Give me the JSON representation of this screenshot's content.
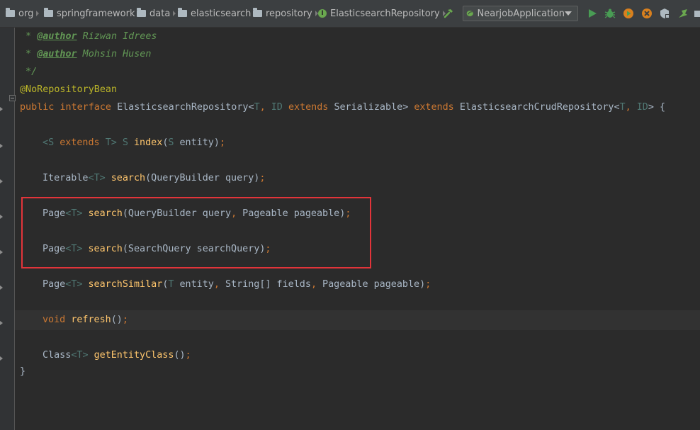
{
  "breadcrumbs": [
    "org",
    "springframework",
    "data",
    "elasticsearch",
    "repository",
    "ElasticsearchRepository"
  ],
  "interface_icon_letter": "I",
  "run_configuration": "NearjobApplication",
  "toolbar_icons": [
    "hammer-icon",
    "run-icon",
    "debug-icon",
    "coverage-icon",
    "profile-icon",
    "stop-icon",
    "jrebel-icon"
  ],
  "colors": {
    "background": "#2b2b2b",
    "keyword": "#cc7832",
    "method": "#ffc66d",
    "comment": "#629755",
    "annotation": "#bbb529",
    "type_param": "#507874",
    "highlight_box": "#e2343a"
  },
  "code": {
    "l1": {
      "star": " * ",
      "tag": "@author",
      "rest": " Rizwan Idrees"
    },
    "l2": {
      "star": " * ",
      "tag": "@author",
      "rest": " Mohsin Husen"
    },
    "l3": " */",
    "l4": "@NoRepositoryBean",
    "l5": {
      "public": "public",
      "interface": "interface",
      "name": "ElasticsearchRepository",
      "lt": "<",
      "T": "T",
      "comma": ",",
      "ID": "ID",
      "extends1": "extends",
      "ser": "Serializable",
      "gt": ">",
      "extends2": "extends",
      "crud": "ElasticsearchCrudRepository",
      "lt2": "<",
      "T2": "T",
      "comma2": ",",
      "ID2": "ID",
      "gt2": ">",
      "brace": "{"
    },
    "l7": {
      "lt": "<",
      "S": "S",
      "extends": "extends",
      "T": "T",
      "gt": ">",
      "S2": "S",
      "fn": "index",
      "lp": "(",
      "S3": "S",
      "arg": "entity",
      "rp": ")",
      "semi": ";"
    },
    "l9": {
      "type": "Iterable",
      "lt": "<",
      "T": "T",
      "gt": ">",
      "fn": "search",
      "args": "(QueryBuilder query)",
      "semi": ";"
    },
    "l11": {
      "type": "Page",
      "lt": "<",
      "T": "T",
      "gt": ">",
      "fn": "search",
      "a1": "(QueryBuilder query",
      "comma": ",",
      "a2": " Pageable pageable)",
      "semi": ";"
    },
    "l13": {
      "type": "Page",
      "lt": "<",
      "T": "T",
      "gt": ">",
      "fn": "search",
      "args": "(SearchQuery searchQuery)",
      "semi": ";"
    },
    "l15": {
      "type": "Page",
      "lt": "<",
      "T": "T",
      "gt": ">",
      "fn": "searchSimilar",
      "lp": "(",
      "T2": "T",
      "a1": " entity",
      "c1": ",",
      "a2": " String[] fields",
      "c2": ",",
      "a3": " Pageable pageable)",
      "semi": ";"
    },
    "l17": {
      "kw": "void",
      "fn": "refresh",
      "args": "()",
      "semi": ";"
    },
    "l19": {
      "type": "Class",
      "lt": "<",
      "T": "T",
      "gt": ">",
      "fn": "getEntityClass",
      "args": "()",
      "semi": ";"
    },
    "l20": "}"
  }
}
